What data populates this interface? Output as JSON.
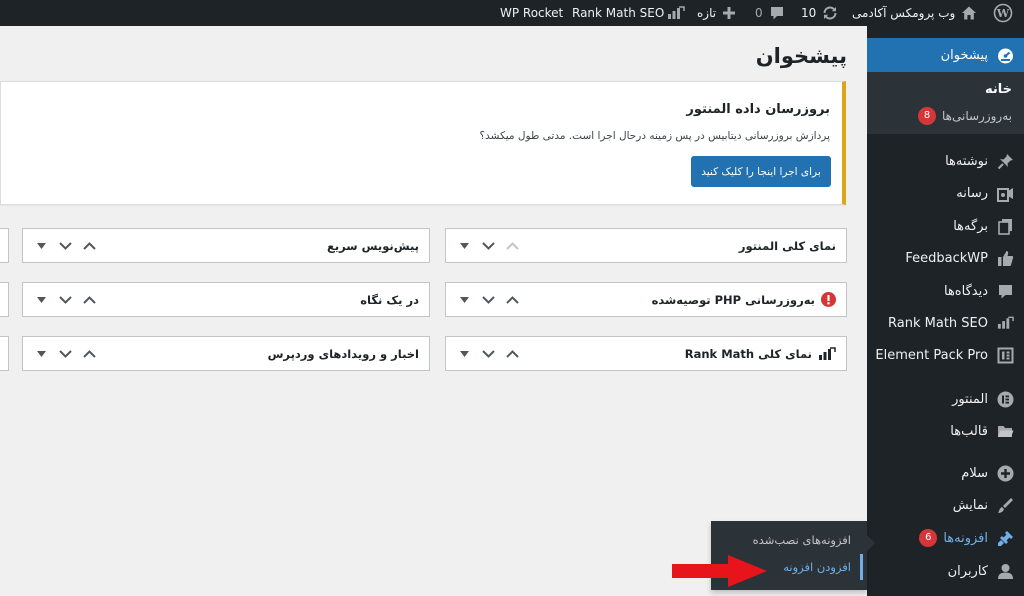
{
  "admin_bar": {
    "site_name": "وب پرومکس آکادمی",
    "updates_count": "10",
    "comments_count": "0",
    "new_label": "تازه",
    "rank_math": "Rank Math SEO",
    "wp_rocket": "WP Rocket"
  },
  "sidebar": {
    "dashboard": "پیشخوان",
    "home": "خانه",
    "updates": "به‌روزرسانی‌ها",
    "updates_badge": "8",
    "posts": "نوشته‌ها",
    "media": "رسانه",
    "pages": "برگه‌ها",
    "feedbackwp": "FeedbackWP",
    "comments": "دیدگاه‌ها",
    "rank_math": "Rank Math SEO",
    "element_pack": "Element Pack Pro",
    "elementor": "المنتور",
    "templates": "قالب‌ها",
    "hello": "سلام",
    "appearance": "نمایش",
    "plugins": "افزونه‌ها",
    "plugins_badge": "6",
    "users": "کاربران"
  },
  "flyout": {
    "installed": "افزونه‌های نصب‌شده",
    "add_new": "افزودن افزونه"
  },
  "page_title": "پیشخوان",
  "notice": {
    "title": "بروزرسان داده المنتور",
    "text": "پردازش بروزرسانی دیتابیس در پس زمینه درحال اجرا است. مدتی طول میکشد؟",
    "button": "برای اجرا اینجا را کلیک کنید"
  },
  "widgets": {
    "elementor_overview": "نمای کلی المنتور",
    "php_update": "به‌روزرسانی PHP توصیه‌شده",
    "rank_math_overview": "نمای کلی Rank Math",
    "quick_draft": "پیش‌نویس سریع",
    "at_a_glance": "در یک نگاه",
    "wp_events": "اخبار و رویدادهای وردپرس"
  },
  "colors": {
    "admin_dark": "#1d2327",
    "accent_blue": "#2271b1",
    "notice_warning": "#dba617",
    "badge_red": "#d63638",
    "arrow_red": "#e8141b"
  },
  "icons": [
    "wordpress-icon",
    "home-icon",
    "refresh-icon",
    "comment-icon",
    "plus-icon",
    "rank-math-icon",
    "dashboard-icon",
    "pin-icon",
    "media-icon",
    "pages-icon",
    "thumbs-up-icon",
    "comment-icon",
    "elementor-icon",
    "element-pack-icon",
    "folder-icon",
    "plus-circle-icon",
    "brush-icon",
    "plugin-icon",
    "user-icon",
    "chevron-up-icon",
    "chevron-down-icon",
    "caret-down-icon",
    "warning-icon",
    "red-arrow"
  ]
}
